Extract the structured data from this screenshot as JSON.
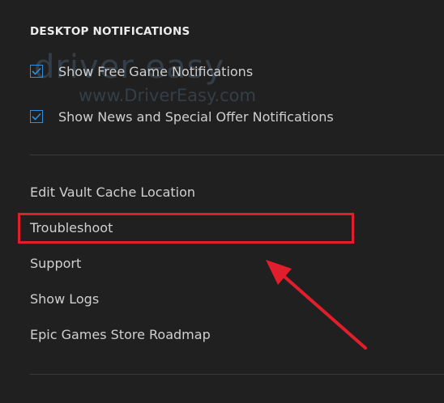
{
  "desktop_notifications": {
    "heading": "DESKTOP NOTIFICATIONS",
    "options": [
      {
        "label": "Show Free Game Notifications",
        "checked": true
      },
      {
        "label": "Show News and Special Offer Notifications",
        "checked": true
      }
    ]
  },
  "links": [
    {
      "label": "Edit Vault Cache Location"
    },
    {
      "label": "Troubleshoot",
      "highlighted": true
    },
    {
      "label": "Support"
    },
    {
      "label": "Show Logs"
    },
    {
      "label": "Epic Games Store Roadmap"
    }
  ],
  "watermark": {
    "logo_text": "driver easy",
    "url_text": "www.DriverEasy.com"
  },
  "colors": {
    "background": "#202020",
    "checkbox_accent": "#2f8fdc",
    "annotation_red": "#e11e2b",
    "divider": "#3a3a3a"
  }
}
